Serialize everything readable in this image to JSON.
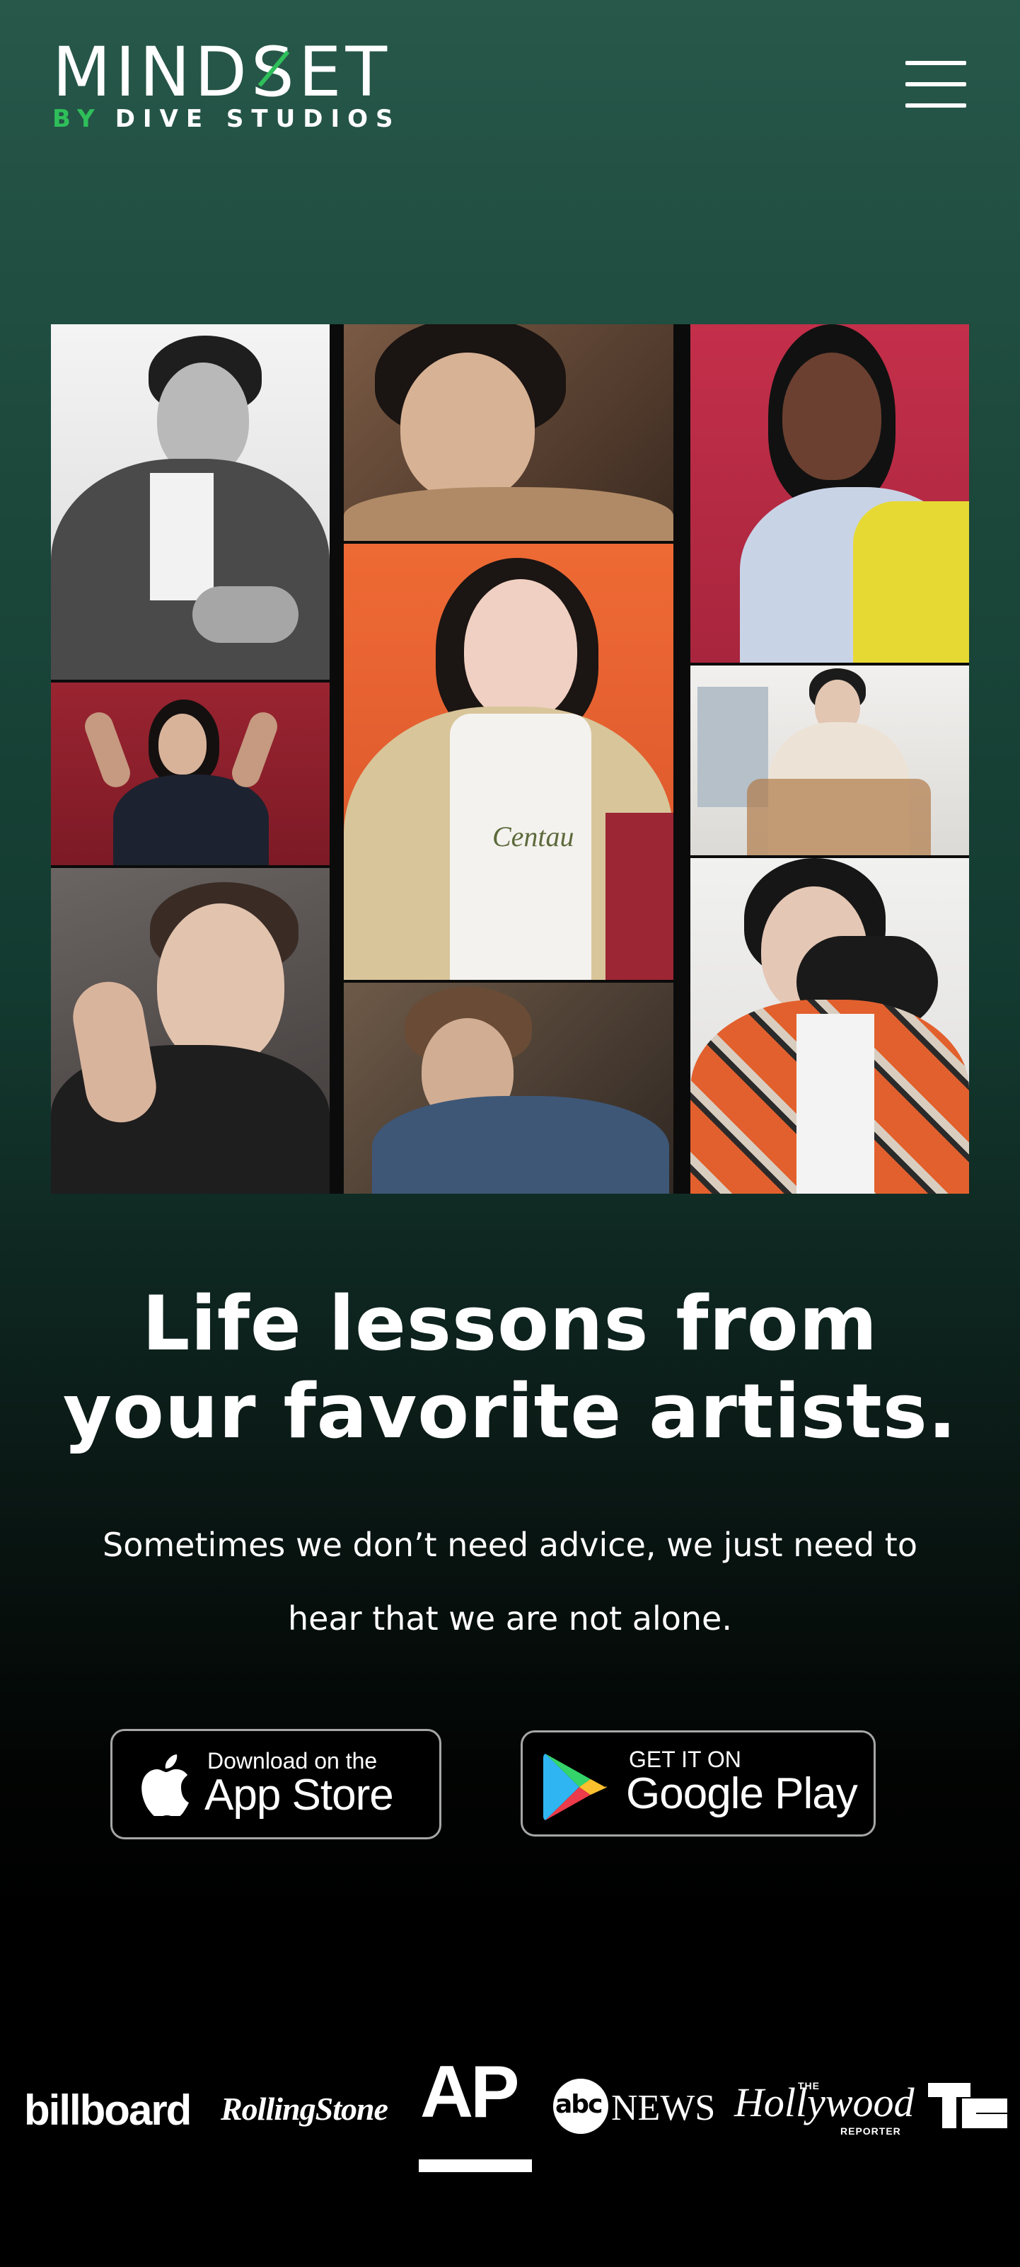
{
  "header": {
    "logo_main": "MINDSET",
    "logo_by": "BY",
    "logo_studio": "DIVE STUDIOS",
    "menu_icon": "hamburger-menu-icon"
  },
  "collage": {
    "photos": [
      {
        "name": "artist-photo-1",
        "bg": "#e9e9e9",
        "tone": "grayscale"
      },
      {
        "name": "artist-photo-2",
        "bg": "#6b4e3a",
        "tone": "warm"
      },
      {
        "name": "artist-photo-3",
        "bg": "#c02f48",
        "tone": "red"
      },
      {
        "name": "artist-photo-4",
        "bg": "#8f1f2b",
        "tone": "deep-red"
      },
      {
        "name": "artist-photo-5",
        "bg": "#e8612c",
        "tone": "orange"
      },
      {
        "name": "artist-photo-6",
        "bg": "#ecebe8",
        "tone": "light"
      },
      {
        "name": "artist-photo-7",
        "bg": "#4e4846",
        "tone": "gray"
      },
      {
        "name": "artist-photo-8",
        "bg": "#5a4e43",
        "tone": "dark"
      },
      {
        "name": "artist-photo-9",
        "bg": "#e8e7e5",
        "tone": "white"
      }
    ],
    "shirt_text": "Centau"
  },
  "hero": {
    "headline_line1": "Life lessons from",
    "headline_line2": "your favorite artists.",
    "subtext_line1": "Sometimes we don’t need advice, we just need to",
    "subtext_line2": "hear that we are not alone."
  },
  "stores": {
    "app_store_small": "Download on the",
    "app_store_big": "App Store",
    "app_store_icon": "apple-icon",
    "google_small": "GET IT ON",
    "google_big": "Google Play",
    "google_icon": "google-play-icon"
  },
  "press": {
    "billboard": "billboard",
    "rolling_stone": "RollingStone",
    "ap": "AP",
    "abc": "abc",
    "news": "NEWS",
    "hollywood": "Hollywood",
    "hollywood_the": "THE",
    "hollywood_reporter": "REPORTER",
    "techcrunch_icon": "techcrunch-logo"
  },
  "colors": {
    "brand_green": "#2fbf5a",
    "header_bg": "#27584a",
    "text": "#ffffff"
  }
}
